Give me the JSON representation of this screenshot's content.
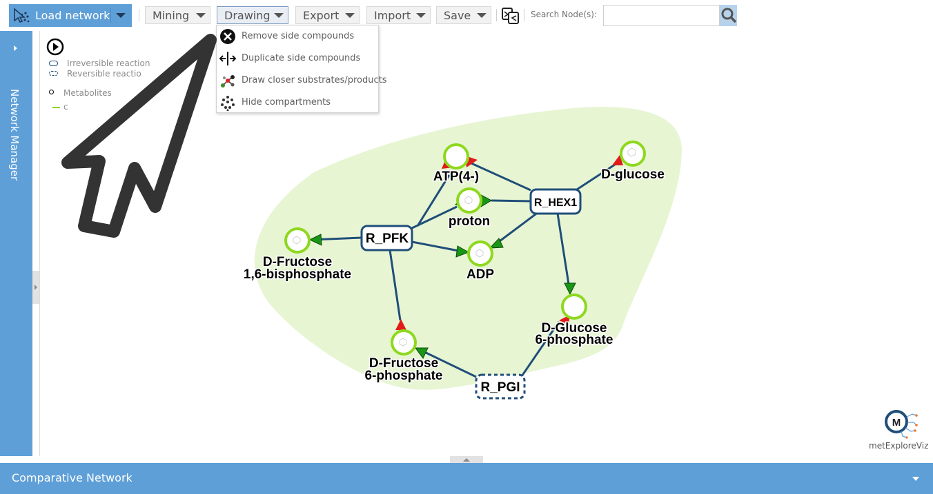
{
  "toolbar": {
    "load_network": "Load network",
    "mining": "Mining",
    "drawing": "Drawing",
    "export": "Export",
    "import": "Import",
    "save": "Save",
    "search_label": "Search Node(s):",
    "search_value": ""
  },
  "drawing_menu": {
    "items": [
      {
        "label": "Remove side compounds",
        "icon": "remove-circle-icon"
      },
      {
        "label": "Duplicate side compounds",
        "icon": "duplicate-arrows-icon"
      },
      {
        "label": "Draw closer substrates/products",
        "icon": "molecule-icon"
      },
      {
        "label": "Hide compartments",
        "icon": "compartment-dots-icon"
      }
    ]
  },
  "sidebar": {
    "network_manager": "Network Manager"
  },
  "legend": {
    "irreversible": "Irreversible reaction",
    "reversible": "Reversible reactio",
    "metabolites": "Metabolites",
    "compartment": "c"
  },
  "network": {
    "metabolites": {
      "atp": "ATP(4-)",
      "dglucose": "D-glucose",
      "proton": "proton",
      "adp": "ADP",
      "fbp_line1": "D-Fructose",
      "fbp_line2": "1,6-bisphosphate",
      "g6p_line1": "D-Glucose",
      "g6p_line2": "6-phosphate",
      "f6p_line1": "D-Fructose",
      "f6p_line2": "6-phosphate"
    },
    "reactions": {
      "hex1": "R_HEX1",
      "pfk": "R_PFK",
      "pgi": "R_PGI"
    }
  },
  "logo": {
    "text": "metExploreViz"
  },
  "bottom_panel": {
    "title": "Comparative Network"
  },
  "colors": {
    "accent": "#5e9fd8",
    "compartment": "#e7f5d3",
    "metabolite_ring": "#8ed81f",
    "edge": "#1f4e79",
    "arrow_green": "#1a9617",
    "arrow_red": "#e11b1b"
  }
}
